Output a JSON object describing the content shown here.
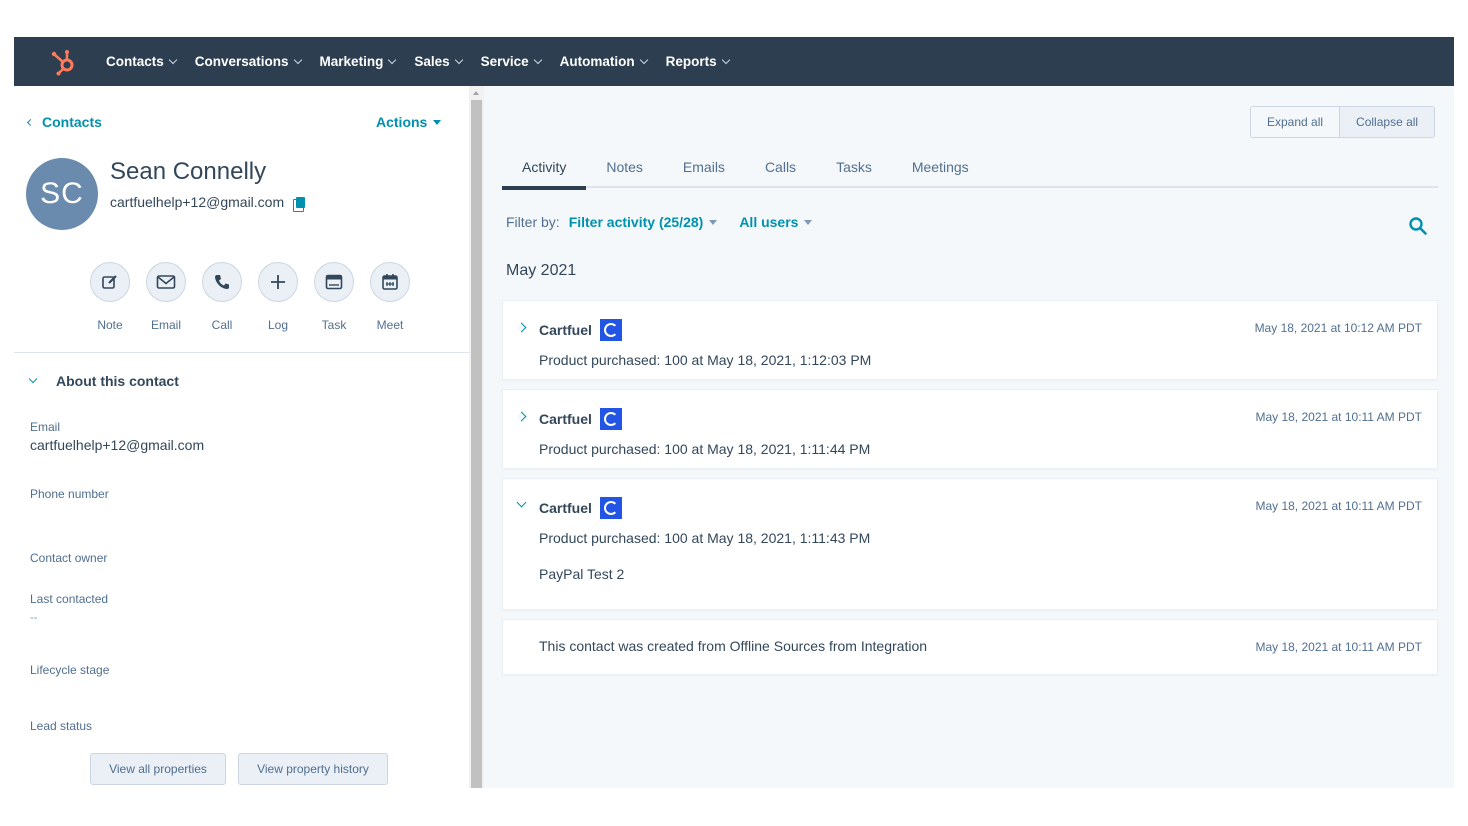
{
  "nav": {
    "items": [
      "Contacts",
      "Conversations",
      "Marketing",
      "Sales",
      "Service",
      "Automation",
      "Reports"
    ]
  },
  "left": {
    "back_label": "Contacts",
    "actions_label": "Actions",
    "avatar_initials": "SC",
    "name": "Sean Connelly",
    "email": "cartfuelhelp+12@gmail.com",
    "quick_actions": [
      {
        "label": "Note",
        "icon": "edit-icon"
      },
      {
        "label": "Email",
        "icon": "email-icon"
      },
      {
        "label": "Call",
        "icon": "phone-icon"
      },
      {
        "label": "Log",
        "icon": "plus-icon"
      },
      {
        "label": "Task",
        "icon": "task-icon"
      },
      {
        "label": "Meet",
        "icon": "calendar-icon"
      }
    ],
    "about_title": "About this contact",
    "props": {
      "email_label": "Email",
      "email_value": "cartfuelhelp+12@gmail.com",
      "phone_label": "Phone number",
      "owner_label": "Contact owner",
      "last_contacted_label": "Last contacted",
      "last_contacted_value": "--",
      "lifecycle_label": "Lifecycle stage",
      "lead_status_label": "Lead status"
    },
    "view_all_label": "View all properties",
    "view_history_label": "View property history"
  },
  "right": {
    "expand_all": "Expand all",
    "collapse_all": "Collapse all",
    "tabs": [
      "Activity",
      "Notes",
      "Emails",
      "Calls",
      "Tasks",
      "Meetings"
    ],
    "active_tab": "Activity",
    "filter_by": "Filter by:",
    "filter_activity": "Filter activity (25/28)",
    "all_users": "All users",
    "month": "May 2021",
    "activities": [
      {
        "title": "Cartfuel",
        "time": "May 18, 2021 at 10:12 AM PDT",
        "body": "Product purchased: 100 at May 18, 2021, 1:12:03 PM",
        "expanded": false
      },
      {
        "title": "Cartfuel",
        "time": "May 18, 2021 at 10:11 AM PDT",
        "body": "Product purchased: 100 at May 18, 2021, 1:11:44 PM",
        "expanded": false
      },
      {
        "title": "Cartfuel",
        "time": "May 18, 2021 at 10:11 AM PDT",
        "body": "Product purchased: 100 at May 18, 2021, 1:11:43 PM",
        "extra": "PayPal Test 2",
        "expanded": true
      }
    ],
    "created_note": "This contact was created from Offline Sources from Integration",
    "created_time": "May 18, 2021 at 10:11 AM PDT"
  },
  "colors": {
    "nav_bg": "#2d3e50",
    "accent": "#0091ae",
    "avatar_bg": "#6a8bae",
    "logo_orange": "#ff7a59",
    "cartfuel_blue": "#2255e3"
  }
}
